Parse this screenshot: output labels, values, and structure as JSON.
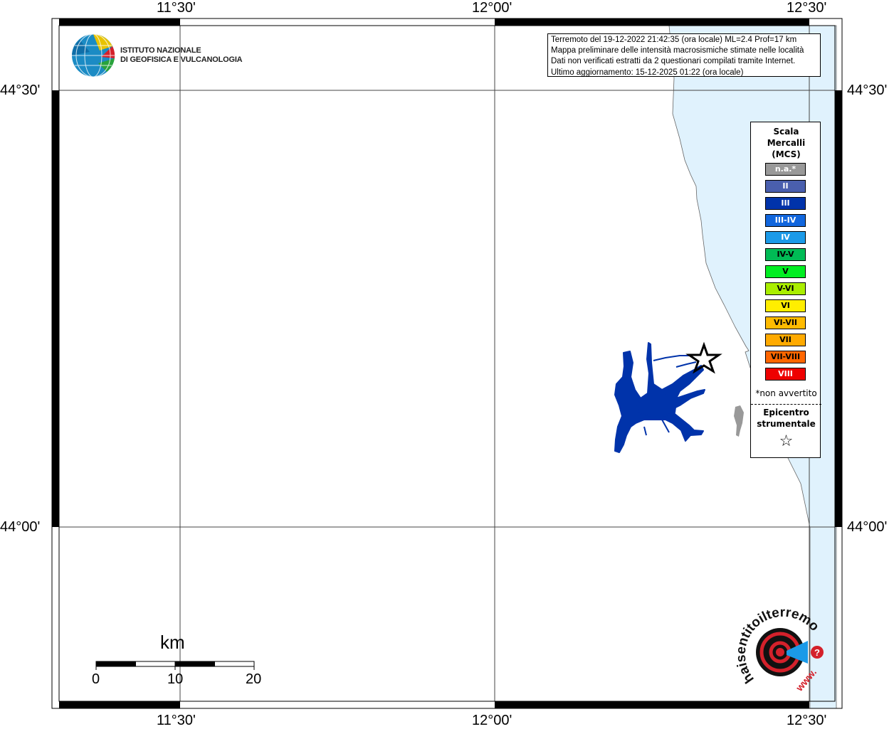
{
  "map": {
    "lon_labels": [
      "11°30'",
      "12°00'",
      "12°30'"
    ],
    "lat_labels": [
      "44°30'",
      "44°00'"
    ]
  },
  "info_box": {
    "lines": [
      "Terremoto del 19-12-2022 21:42:35 (ora locale) ML=2.4 Prof=17 km",
      "Mappa preliminare delle intensità macrosismiche stimate nelle località",
      "Dati non verificati estratti da 2 questionari compilati tramite Internet.",
      "Ultimo aggiornamento: 15-12-2025 01:22 (ora locale)"
    ]
  },
  "logo": {
    "line1": "ISTITUTO NAZIONALE",
    "line2": "DI GEOFISICA E VULCANOLOGIA"
  },
  "legend": {
    "title": [
      "Scala",
      "Mercalli",
      "(MCS)"
    ],
    "items": [
      {
        "label": "n.a.*",
        "color": "#999999",
        "text_color": "#ffffff"
      },
      {
        "label": "II",
        "color": "#4a5fae",
        "text_color": "#ffffff"
      },
      {
        "label": "III",
        "color": "#0033aa",
        "text_color": "#ffffff"
      },
      {
        "label": "III-IV",
        "color": "#1166dd",
        "text_color": "#ffffff"
      },
      {
        "label": "IV",
        "color": "#1b9ae8",
        "text_color": "#ffffff"
      },
      {
        "label": "IV-V",
        "color": "#00bb55",
        "text_color": "#000000"
      },
      {
        "label": "V",
        "color": "#00ee22",
        "text_color": "#000000"
      },
      {
        "label": "V-VI",
        "color": "#aaee00",
        "text_color": "#000000"
      },
      {
        "label": "VI",
        "color": "#ffee00",
        "text_color": "#000000"
      },
      {
        "label": "VI-VII",
        "color": "#ffbb00",
        "text_color": "#000000"
      },
      {
        "label": "VII",
        "color": "#ffaa00",
        "text_color": "#000000"
      },
      {
        "label": "VII-VIII",
        "color": "#ff6600",
        "text_color": "#000000"
      },
      {
        "label": "VIII",
        "color": "#ee0000",
        "text_color": "#ffffff"
      }
    ],
    "not_felt": "*non avvertito",
    "epicenter": [
      "Epicentro",
      "strumentale"
    ],
    "epicenter_symbol": "☆"
  },
  "scale_bar": {
    "unit": "km",
    "ticks": [
      "0",
      "10",
      "20"
    ]
  },
  "watermark": {
    "text": "haisentitoilterremoto.it",
    "www": "www.",
    "question": "?"
  },
  "colors": {
    "sea": "#e0f2fd",
    "intensity_III": "#0033aa",
    "na_gray": "#999999"
  }
}
